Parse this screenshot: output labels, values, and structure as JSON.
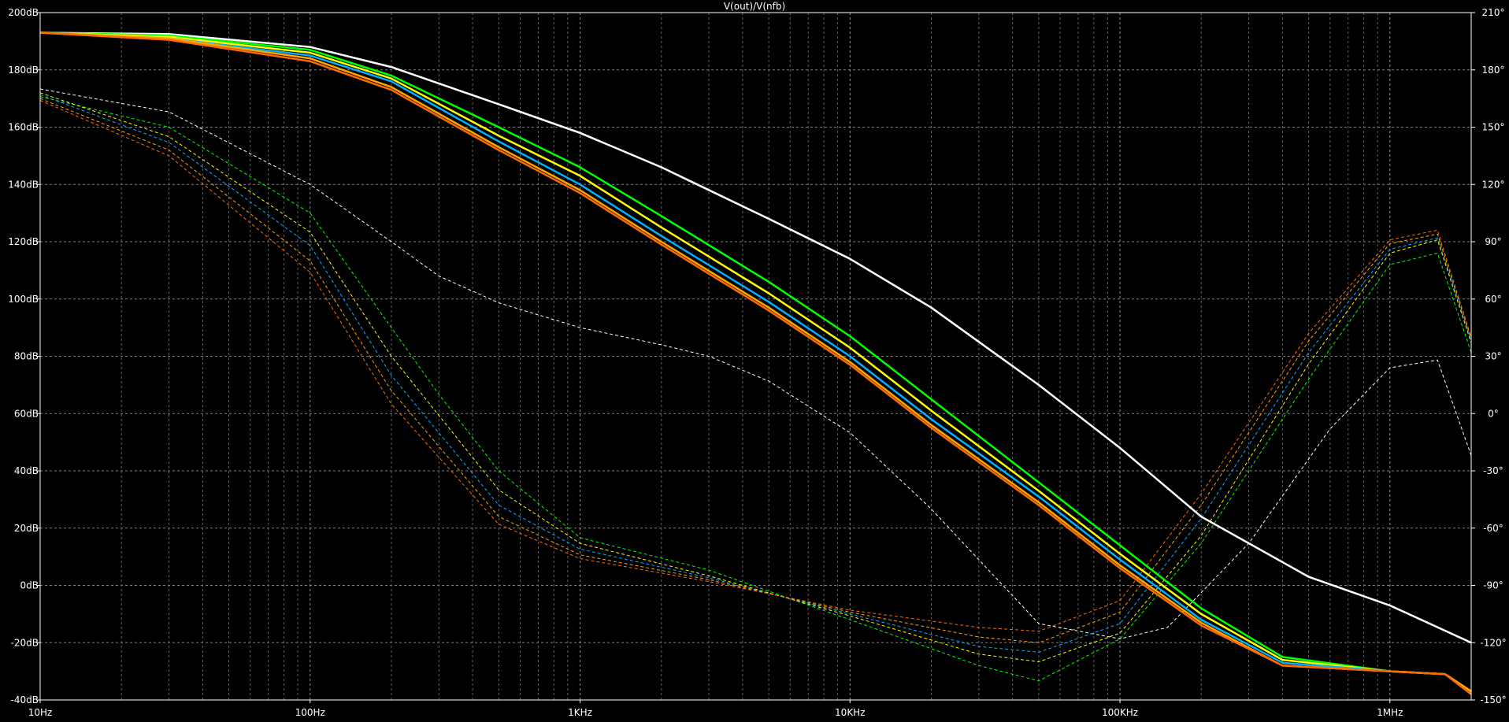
{
  "window": {
    "title": "V(out)/V(nfb)"
  },
  "chart_data": {
    "type": "line",
    "title": "V(out)/V(nfb)",
    "x_scale": "log",
    "xlim": [
      10,
      2000000
    ],
    "ylim_left": [
      -40,
      200
    ],
    "ylim_right": [
      -150,
      210
    ],
    "x_ticks": [
      {
        "value": 10,
        "label": "10Hz"
      },
      {
        "value": 100,
        "label": "100Hz"
      },
      {
        "value": 1000,
        "label": "1KHz"
      },
      {
        "value": 10000,
        "label": "10KHz"
      },
      {
        "value": 100000,
        "label": "100KHz"
      },
      {
        "value": 1000000,
        "label": "1MHz"
      }
    ],
    "y_ticks_left": [
      {
        "value": 200,
        "label": "200dB"
      },
      {
        "value": 180,
        "label": "180dB"
      },
      {
        "value": 160,
        "label": "160dB"
      },
      {
        "value": 140,
        "label": "140dB"
      },
      {
        "value": 120,
        "label": "120dB"
      },
      {
        "value": 100,
        "label": "100dB"
      },
      {
        "value": 80,
        "label": "80dB"
      },
      {
        "value": 60,
        "label": "60dB"
      },
      {
        "value": 40,
        "label": "40dB"
      },
      {
        "value": 20,
        "label": "20dB"
      },
      {
        "value": 0,
        "label": "0dB"
      },
      {
        "value": -20,
        "label": "-20dB"
      },
      {
        "value": -40,
        "label": "-40dB"
      }
    ],
    "y_ticks_right": [
      {
        "value": 210,
        "label": "210°"
      },
      {
        "value": 180,
        "label": "180°"
      },
      {
        "value": 150,
        "label": "150°"
      },
      {
        "value": 120,
        "label": "120°"
      },
      {
        "value": 90,
        "label": "90°"
      },
      {
        "value": 60,
        "label": "60°"
      },
      {
        "value": 30,
        "label": "30°"
      },
      {
        "value": 0,
        "label": "0°"
      },
      {
        "value": -30,
        "label": "-30°"
      },
      {
        "value": -60,
        "label": "-60°"
      },
      {
        "value": -90,
        "label": "-90°"
      },
      {
        "value": -120,
        "label": "-120°"
      },
      {
        "value": -150,
        "label": "-150°"
      }
    ],
    "grid": true,
    "magnitude_series": [
      {
        "color": "#ffffff",
        "points": [
          [
            10,
            193
          ],
          [
            30,
            192.5
          ],
          [
            100,
            188
          ],
          [
            200,
            181
          ],
          [
            500,
            168
          ],
          [
            1000,
            158
          ],
          [
            2000,
            146
          ],
          [
            5000,
            128
          ],
          [
            10000,
            114
          ],
          [
            20000,
            97
          ],
          [
            50000,
            70
          ],
          [
            100000,
            48
          ],
          [
            200000,
            24
          ],
          [
            500000,
            3
          ],
          [
            1000000,
            -7
          ],
          [
            2000000,
            -20
          ]
        ]
      },
      {
        "color": "#00ff00",
        "points": [
          [
            10,
            193
          ],
          [
            30,
            192
          ],
          [
            100,
            187
          ],
          [
            200,
            178
          ],
          [
            500,
            160
          ],
          [
            1000,
            146
          ],
          [
            2000,
            129
          ],
          [
            5000,
            106
          ],
          [
            10000,
            87
          ],
          [
            20000,
            65
          ],
          [
            50000,
            36
          ],
          [
            100000,
            14
          ],
          [
            200000,
            -8
          ],
          [
            400000,
            -25
          ],
          [
            1000000,
            -30
          ],
          [
            1600000,
            -31
          ],
          [
            2000000,
            -37
          ]
        ]
      },
      {
        "color": "#ffff00",
        "points": [
          [
            10,
            193
          ],
          [
            30,
            191.5
          ],
          [
            100,
            186
          ],
          [
            200,
            177
          ],
          [
            500,
            157
          ],
          [
            1000,
            143
          ],
          [
            2000,
            125
          ],
          [
            5000,
            102
          ],
          [
            10000,
            83
          ],
          [
            20000,
            61
          ],
          [
            50000,
            33
          ],
          [
            100000,
            11
          ],
          [
            200000,
            -10
          ],
          [
            400000,
            -26
          ],
          [
            1000000,
            -30
          ],
          [
            1600000,
            -31
          ],
          [
            2000000,
            -37
          ]
        ]
      },
      {
        "color": "#00b0ff",
        "points": [
          [
            10,
            193
          ],
          [
            30,
            191
          ],
          [
            100,
            185
          ],
          [
            200,
            176
          ],
          [
            500,
            155
          ],
          [
            1000,
            140
          ],
          [
            2000,
            122
          ],
          [
            5000,
            99
          ],
          [
            10000,
            80
          ],
          [
            20000,
            58
          ],
          [
            50000,
            31
          ],
          [
            100000,
            9
          ],
          [
            200000,
            -12
          ],
          [
            400000,
            -27
          ],
          [
            1000000,
            -30
          ],
          [
            1600000,
            -31
          ],
          [
            2000000,
            -37
          ]
        ]
      },
      {
        "color": "#ffa500",
        "points": [
          [
            10,
            193
          ],
          [
            30,
            191
          ],
          [
            100,
            184
          ],
          [
            200,
            174
          ],
          [
            500,
            153
          ],
          [
            1000,
            138
          ],
          [
            2000,
            120
          ],
          [
            5000,
            97
          ],
          [
            10000,
            78
          ],
          [
            20000,
            56
          ],
          [
            50000,
            29
          ],
          [
            100000,
            7
          ],
          [
            200000,
            -13
          ],
          [
            400000,
            -28
          ],
          [
            1000000,
            -30
          ],
          [
            1600000,
            -31
          ],
          [
            2000000,
            -37
          ]
        ]
      },
      {
        "color": "#ff6a00",
        "points": [
          [
            10,
            193
          ],
          [
            30,
            190.5
          ],
          [
            100,
            183
          ],
          [
            200,
            173
          ],
          [
            500,
            152
          ],
          [
            1000,
            137
          ],
          [
            2000,
            119
          ],
          [
            5000,
            96
          ],
          [
            10000,
            77
          ],
          [
            20000,
            55
          ],
          [
            50000,
            28
          ],
          [
            100000,
            6
          ],
          [
            200000,
            -14
          ],
          [
            400000,
            -28
          ],
          [
            1000000,
            -30
          ],
          [
            1600000,
            -31
          ],
          [
            2000000,
            -38
          ]
        ]
      }
    ],
    "phase_series": [
      {
        "color": "#ffffff",
        "points": [
          [
            10,
            170
          ],
          [
            30,
            158
          ],
          [
            100,
            120
          ],
          [
            200,
            90
          ],
          [
            300,
            72
          ],
          [
            500,
            58
          ],
          [
            1000,
            45
          ],
          [
            2000,
            36
          ],
          [
            3000,
            30
          ],
          [
            5000,
            17
          ],
          [
            10000,
            -10
          ],
          [
            20000,
            -50
          ],
          [
            50000,
            -110
          ],
          [
            100000,
            -118
          ],
          [
            150000,
            -112
          ],
          [
            300000,
            -68
          ],
          [
            600000,
            -8
          ],
          [
            1000000,
            24
          ],
          [
            1500000,
            28
          ],
          [
            2000000,
            -22
          ]
        ]
      },
      {
        "color": "#00ff00",
        "points": [
          [
            10,
            166
          ],
          [
            30,
            150
          ],
          [
            100,
            105
          ],
          [
            200,
            45
          ],
          [
            300,
            10
          ],
          [
            500,
            -30
          ],
          [
            1000,
            -65
          ],
          [
            3000,
            -82
          ],
          [
            10000,
            -108
          ],
          [
            30000,
            -132
          ],
          [
            50000,
            -140
          ],
          [
            100000,
            -118
          ],
          [
            200000,
            -68
          ],
          [
            500000,
            18
          ],
          [
            1000000,
            78
          ],
          [
            1500000,
            84
          ],
          [
            2000000,
            32
          ]
        ]
      },
      {
        "color": "#ffff00",
        "points": [
          [
            10,
            168
          ],
          [
            30,
            145
          ],
          [
            100,
            95
          ],
          [
            200,
            30
          ],
          [
            500,
            -40
          ],
          [
            1000,
            -68
          ],
          [
            3000,
            -85
          ],
          [
            10000,
            -106
          ],
          [
            30000,
            -126
          ],
          [
            50000,
            -130
          ],
          [
            100000,
            -115
          ],
          [
            200000,
            -64
          ],
          [
            500000,
            26
          ],
          [
            1000000,
            84
          ],
          [
            1500000,
            91
          ],
          [
            2000000,
            37
          ]
        ]
      },
      {
        "color": "#00b0ff",
        "points": [
          [
            10,
            167
          ],
          [
            30,
            142
          ],
          [
            100,
            88
          ],
          [
            200,
            20
          ],
          [
            500,
            -48
          ],
          [
            1000,
            -71
          ],
          [
            3000,
            -86
          ],
          [
            10000,
            -105
          ],
          [
            30000,
            -122
          ],
          [
            50000,
            -125
          ],
          [
            100000,
            -110
          ],
          [
            200000,
            -55
          ],
          [
            500000,
            32
          ],
          [
            1000000,
            86
          ],
          [
            1500000,
            92
          ],
          [
            2000000,
            38
          ]
        ]
      },
      {
        "color": "#ffa500",
        "points": [
          [
            10,
            165
          ],
          [
            30,
            138
          ],
          [
            100,
            80
          ],
          [
            200,
            12
          ],
          [
            500,
            -54
          ],
          [
            1000,
            -74
          ],
          [
            3000,
            -87
          ],
          [
            10000,
            -104
          ],
          [
            30000,
            -117
          ],
          [
            50000,
            -120
          ],
          [
            100000,
            -104
          ],
          [
            200000,
            -48
          ],
          [
            500000,
            38
          ],
          [
            1000000,
            89
          ],
          [
            1500000,
            94
          ],
          [
            2000000,
            39
          ]
        ]
      },
      {
        "color": "#ff6a00",
        "points": [
          [
            10,
            164
          ],
          [
            30,
            135
          ],
          [
            100,
            74
          ],
          [
            200,
            5
          ],
          [
            500,
            -58
          ],
          [
            1000,
            -76
          ],
          [
            3000,
            -88
          ],
          [
            10000,
            -103
          ],
          [
            30000,
            -112
          ],
          [
            50000,
            -114
          ],
          [
            100000,
            -98
          ],
          [
            200000,
            -42
          ],
          [
            500000,
            42
          ],
          [
            1000000,
            91
          ],
          [
            1500000,
            96
          ],
          [
            2000000,
            40
          ]
        ]
      }
    ]
  }
}
